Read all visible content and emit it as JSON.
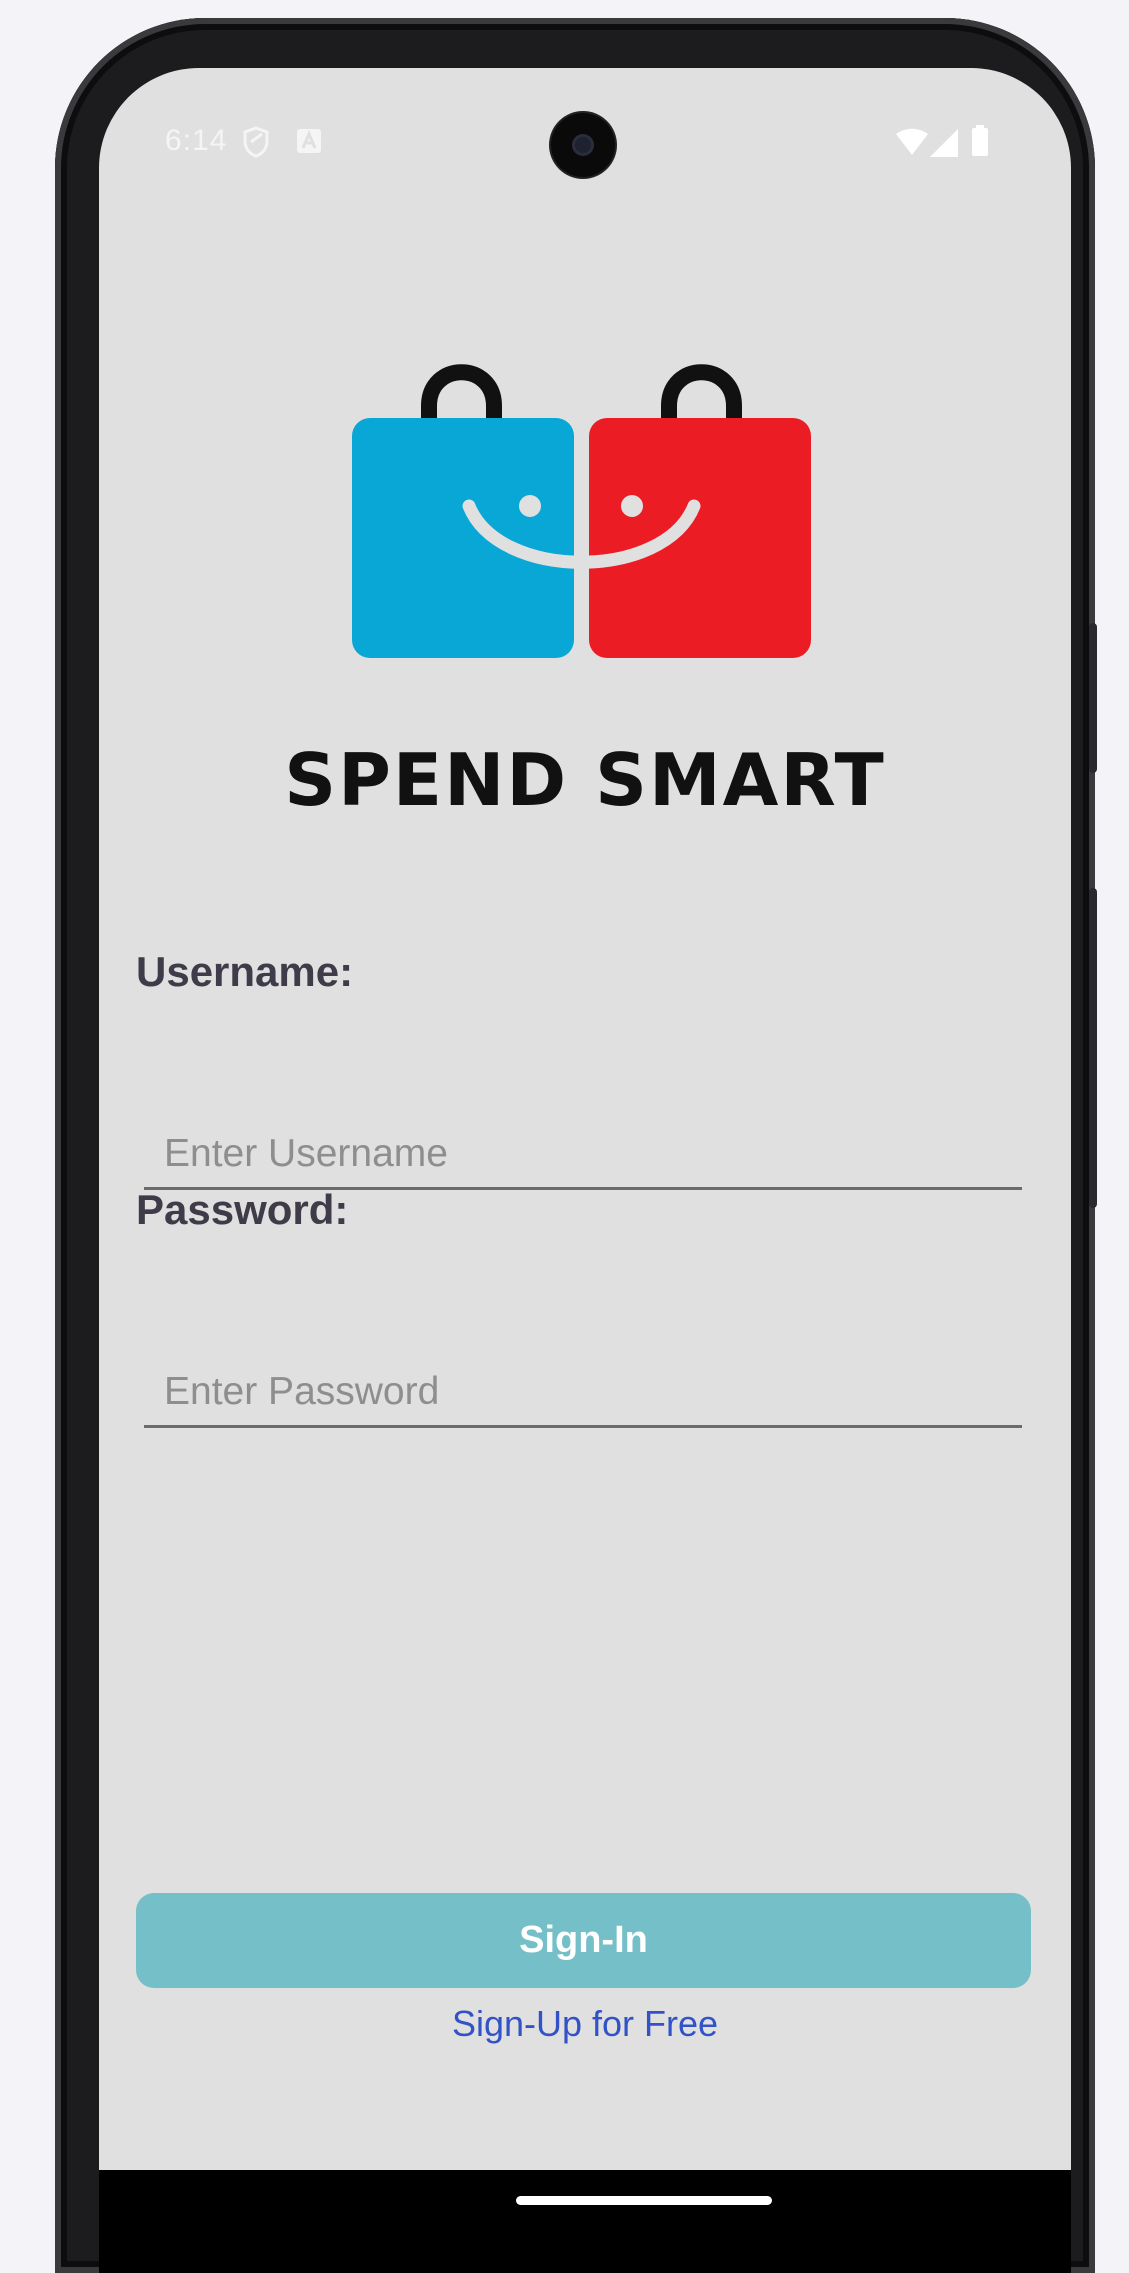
{
  "status_bar": {
    "time": "6:14",
    "icons": [
      "shield-icon",
      "a-badge-icon",
      "wifi-icon",
      "signal-icon",
      "battery-icon"
    ]
  },
  "logo": {
    "brand_text": "SPEND SMART",
    "colors": {
      "left_bag": "#08a7d6",
      "right_bag": "#ec1c24",
      "handle": "#111111",
      "smile": "#e0e0e0"
    }
  },
  "form": {
    "username_label": "Username:",
    "username_placeholder": "Enter Username",
    "password_label": "Password:",
    "password_placeholder": "Enter Password"
  },
  "actions": {
    "signin_label": "Sign-In",
    "signup_label": "Sign-Up for Free",
    "signin_color": "#75bfc8",
    "signup_color": "#3253c7"
  }
}
